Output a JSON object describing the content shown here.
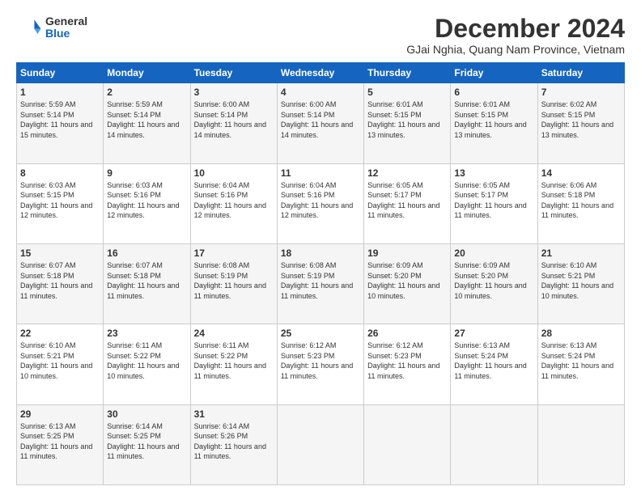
{
  "header": {
    "logo_general": "General",
    "logo_blue": "Blue",
    "month_title": "December 2024",
    "location": "GJai Nghia, Quang Nam Province, Vietnam"
  },
  "weekdays": [
    "Sunday",
    "Monday",
    "Tuesday",
    "Wednesday",
    "Thursday",
    "Friday",
    "Saturday"
  ],
  "weeks": [
    [
      {
        "day": "1",
        "sunrise": "5:59 AM",
        "sunset": "5:14 PM",
        "daylight": "11 hours and 15 minutes."
      },
      {
        "day": "2",
        "sunrise": "5:59 AM",
        "sunset": "5:14 PM",
        "daylight": "11 hours and 14 minutes."
      },
      {
        "day": "3",
        "sunrise": "6:00 AM",
        "sunset": "5:14 PM",
        "daylight": "11 hours and 14 minutes."
      },
      {
        "day": "4",
        "sunrise": "6:00 AM",
        "sunset": "5:14 PM",
        "daylight": "11 hours and 14 minutes."
      },
      {
        "day": "5",
        "sunrise": "6:01 AM",
        "sunset": "5:15 PM",
        "daylight": "11 hours and 13 minutes."
      },
      {
        "day": "6",
        "sunrise": "6:01 AM",
        "sunset": "5:15 PM",
        "daylight": "11 hours and 13 minutes."
      },
      {
        "day": "7",
        "sunrise": "6:02 AM",
        "sunset": "5:15 PM",
        "daylight": "11 hours and 13 minutes."
      }
    ],
    [
      {
        "day": "8",
        "sunrise": "6:03 AM",
        "sunset": "5:15 PM",
        "daylight": "11 hours and 12 minutes."
      },
      {
        "day": "9",
        "sunrise": "6:03 AM",
        "sunset": "5:16 PM",
        "daylight": "11 hours and 12 minutes."
      },
      {
        "day": "10",
        "sunrise": "6:04 AM",
        "sunset": "5:16 PM",
        "daylight": "11 hours and 12 minutes."
      },
      {
        "day": "11",
        "sunrise": "6:04 AM",
        "sunset": "5:16 PM",
        "daylight": "11 hours and 12 minutes."
      },
      {
        "day": "12",
        "sunrise": "6:05 AM",
        "sunset": "5:17 PM",
        "daylight": "11 hours and 11 minutes."
      },
      {
        "day": "13",
        "sunrise": "6:05 AM",
        "sunset": "5:17 PM",
        "daylight": "11 hours and 11 minutes."
      },
      {
        "day": "14",
        "sunrise": "6:06 AM",
        "sunset": "5:18 PM",
        "daylight": "11 hours and 11 minutes."
      }
    ],
    [
      {
        "day": "15",
        "sunrise": "6:07 AM",
        "sunset": "5:18 PM",
        "daylight": "11 hours and 11 minutes."
      },
      {
        "day": "16",
        "sunrise": "6:07 AM",
        "sunset": "5:18 PM",
        "daylight": "11 hours and 11 minutes."
      },
      {
        "day": "17",
        "sunrise": "6:08 AM",
        "sunset": "5:19 PM",
        "daylight": "11 hours and 11 minutes."
      },
      {
        "day": "18",
        "sunrise": "6:08 AM",
        "sunset": "5:19 PM",
        "daylight": "11 hours and 11 minutes."
      },
      {
        "day": "19",
        "sunrise": "6:09 AM",
        "sunset": "5:20 PM",
        "daylight": "11 hours and 10 minutes."
      },
      {
        "day": "20",
        "sunrise": "6:09 AM",
        "sunset": "5:20 PM",
        "daylight": "11 hours and 10 minutes."
      },
      {
        "day": "21",
        "sunrise": "6:10 AM",
        "sunset": "5:21 PM",
        "daylight": "11 hours and 10 minutes."
      }
    ],
    [
      {
        "day": "22",
        "sunrise": "6:10 AM",
        "sunset": "5:21 PM",
        "daylight": "11 hours and 10 minutes."
      },
      {
        "day": "23",
        "sunrise": "6:11 AM",
        "sunset": "5:22 PM",
        "daylight": "11 hours and 10 minutes."
      },
      {
        "day": "24",
        "sunrise": "6:11 AM",
        "sunset": "5:22 PM",
        "daylight": "11 hours and 11 minutes."
      },
      {
        "day": "25",
        "sunrise": "6:12 AM",
        "sunset": "5:23 PM",
        "daylight": "11 hours and 11 minutes."
      },
      {
        "day": "26",
        "sunrise": "6:12 AM",
        "sunset": "5:23 PM",
        "daylight": "11 hours and 11 minutes."
      },
      {
        "day": "27",
        "sunrise": "6:13 AM",
        "sunset": "5:24 PM",
        "daylight": "11 hours and 11 minutes."
      },
      {
        "day": "28",
        "sunrise": "6:13 AM",
        "sunset": "5:24 PM",
        "daylight": "11 hours and 11 minutes."
      }
    ],
    [
      {
        "day": "29",
        "sunrise": "6:13 AM",
        "sunset": "5:25 PM",
        "daylight": "11 hours and 11 minutes."
      },
      {
        "day": "30",
        "sunrise": "6:14 AM",
        "sunset": "5:25 PM",
        "daylight": "11 hours and 11 minutes."
      },
      {
        "day": "31",
        "sunrise": "6:14 AM",
        "sunset": "5:26 PM",
        "daylight": "11 hours and 11 minutes."
      },
      null,
      null,
      null,
      null
    ]
  ]
}
